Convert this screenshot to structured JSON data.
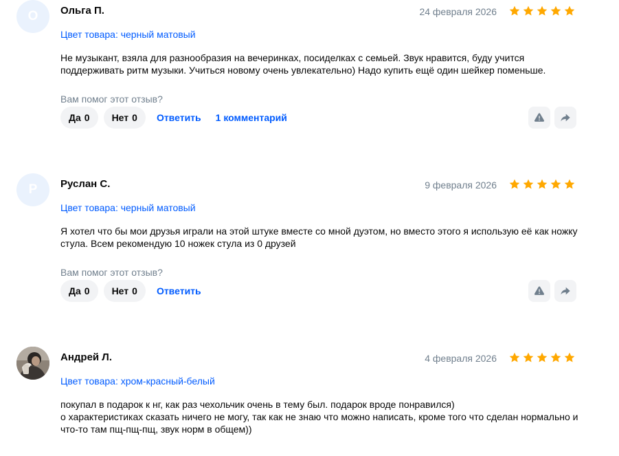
{
  "colors": {
    "accent": "#005bff",
    "star": "#ffa800",
    "muted": "#707f8d",
    "button_bg": "#f2f3f5",
    "avatar_bg": "#eaf2fd"
  },
  "reviews": [
    {
      "avatar_letter": "О",
      "author": "Ольга П.",
      "date": "24 февраля 2026",
      "rating": 5,
      "variant": "Цвет товара: черный матовый",
      "text": "Не музыкант, взяла для разнообразия на вечеринках, посиделках с семьей. Звук нравится, буду учится поддерживать ритм музыки. Учиться новому очень увлекательно) Надо купить ещё один шейкер поменьше.",
      "helpful_question": "Вам помог этот отзыв?",
      "yes_label": "Да",
      "yes_count": "0",
      "no_label": "Нет",
      "no_count": "0",
      "reply_label": "Ответить",
      "comments_label": "1 комментарий"
    },
    {
      "avatar_letter": "Р",
      "author": "Руслан С.",
      "date": "9 февраля 2026",
      "rating": 5,
      "variant": "Цвет товара: черный матовый",
      "text": "Я хотел что бы мои друзья играли на этой штуке вместе со мной дуэтом, но вместо этого я использую её как ножку стула. Всем рекомендую 10 ножек стула из 0 друзей",
      "helpful_question": "Вам помог этот отзыв?",
      "yes_label": "Да",
      "yes_count": "0",
      "no_label": "Нет",
      "no_count": "0",
      "reply_label": "Ответить"
    },
    {
      "author": "Андрей Л.",
      "date": "4 февраля 2026",
      "rating": 5,
      "variant": "Цвет товара: хром-красный-белый",
      "text": "покупал в подарок к нг, как раз чехольчик очень в тему был. подарок вроде понравился)\nо характеристиках сказать ничего не могу, так как не знаю что можно написать, кроме того что сделан нормально и что-то там пщ-пщ-пщ, звук норм в общем))"
    }
  ],
  "icons": {
    "star": "star-icon",
    "report": "warning-icon",
    "share": "share-icon"
  }
}
